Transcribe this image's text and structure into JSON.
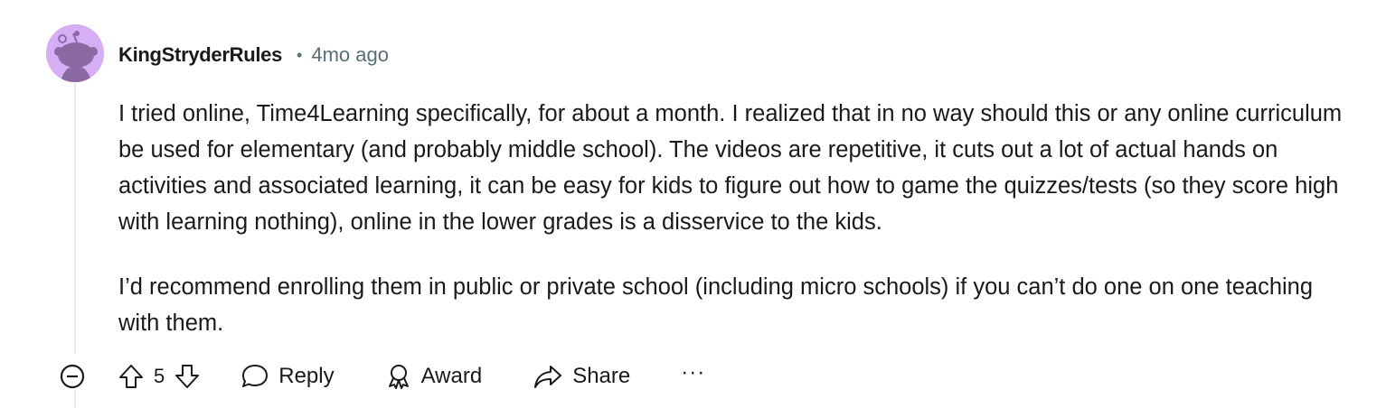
{
  "comment": {
    "author": "KingStryderRules",
    "separator": "•",
    "age": "4mo ago",
    "paragraphs": [
      "I tried online, Time4Learning specifically, for about a month. I realized that in no way should this or any online curriculum be used for elementary (and probably middle school). The videos are repetitive, it cuts out a lot of actual hands on activities and associated learning, it can be easy for kids to figure out how to game the quizzes/tests (so they score high with learning nothing), online in the lower grades is a disservice to the kids.",
      "I’d recommend enrolling them in public or private school (including micro schools) if you can’t do one on one teaching with them."
    ],
    "score": "5"
  },
  "actions": {
    "reply_label": "Reply",
    "award_label": "Award",
    "share_label": "Share",
    "more_label": "···"
  },
  "icons": {
    "collapse": "minus-circle-icon",
    "upvote": "upvote-arrow-icon",
    "downvote": "downvote-arrow-icon",
    "reply": "speech-bubble-icon",
    "award": "award-ribbon-icon",
    "share": "share-arrow-icon"
  },
  "colors": {
    "avatar_background": "#d5aef3",
    "avatar_figure": "#8b6aa3",
    "meta_text": "#576f76",
    "thread_line": "#e5ebee"
  }
}
